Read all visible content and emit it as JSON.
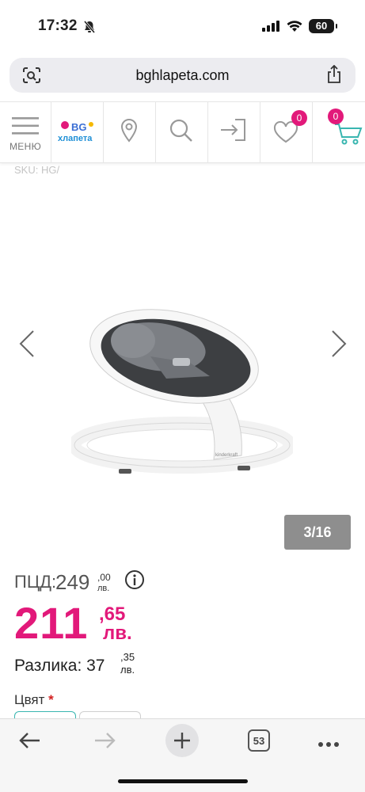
{
  "status": {
    "time": "17:32",
    "battery": "60"
  },
  "browser": {
    "url": "bghlapeta.com",
    "tabs_count": "53"
  },
  "nav": {
    "menu_label": "МЕНЮ",
    "logo_text_1": "BG",
    "logo_text_2": "хлапета",
    "wishlist_count": "0",
    "cart_count": "0"
  },
  "product": {
    "sku": "SKU: HG/",
    "image_counter": "3/16",
    "pcd_label": "ПЦД:",
    "pcd_value": "249",
    "pcd_decimals": ",00",
    "pcd_currency": "лв.",
    "price_integer": "211",
    "price_decimals": ",65",
    "price_currency": "лв.",
    "difference_label": "Разлика: 37",
    "difference_decimals": ",35",
    "difference_currency": "лв.",
    "color_label": "Цвят",
    "required_mark": "*"
  },
  "colors": {
    "accent": "#e2197a",
    "teal": "#39b6b0"
  }
}
